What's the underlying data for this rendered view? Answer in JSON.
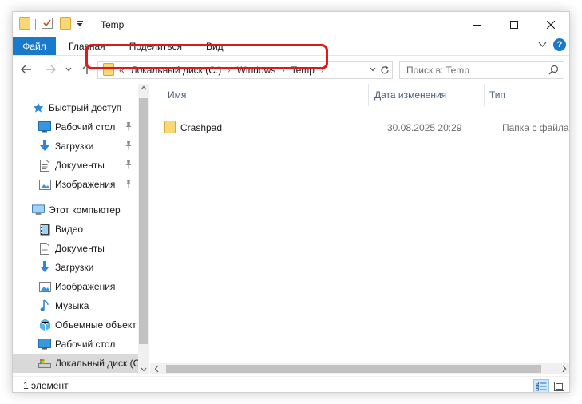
{
  "window": {
    "title": "Temp"
  },
  "ribbon": {
    "file_tab": "Файл",
    "tabs": [
      "Главная",
      "Поделиться",
      "Вид"
    ]
  },
  "address": {
    "overflow": "«",
    "crumbs": [
      "Локальный диск (C:)",
      "Windows",
      "Temp"
    ]
  },
  "search": {
    "placeholder": "Поиск в: Temp"
  },
  "sidebar": {
    "items": [
      {
        "label": "Быстрый доступ",
        "icon": "star-icon",
        "indent": 0,
        "pinned": false
      },
      {
        "label": "Рабочий стол",
        "icon": "desktop-icon",
        "indent": 1,
        "pinned": true
      },
      {
        "label": "Загрузки",
        "icon": "download-arrow-icon",
        "indent": 1,
        "pinned": true
      },
      {
        "label": "Документы",
        "icon": "document-icon",
        "indent": 1,
        "pinned": true
      },
      {
        "label": "Изображения",
        "icon": "pictures-icon",
        "indent": 1,
        "pinned": true
      },
      {
        "label": "Этот компьютер",
        "icon": "computer-icon",
        "indent": 0,
        "pinned": false
      },
      {
        "label": "Видео",
        "icon": "video-icon",
        "indent": 1,
        "pinned": false
      },
      {
        "label": "Документы",
        "icon": "document-icon",
        "indent": 1,
        "pinned": false
      },
      {
        "label": "Загрузки",
        "icon": "download-arrow-icon",
        "indent": 1,
        "pinned": false
      },
      {
        "label": "Изображения",
        "icon": "pictures-icon",
        "indent": 1,
        "pinned": false
      },
      {
        "label": "Музыка",
        "icon": "music-note-icon",
        "indent": 1,
        "pinned": false
      },
      {
        "label": "Объемные объект",
        "icon": "3d-objects-icon",
        "indent": 1,
        "pinned": false
      },
      {
        "label": "Рабочий стол",
        "icon": "desktop-icon",
        "indent": 1,
        "pinned": false
      },
      {
        "label": "Локальный диск (С",
        "icon": "drive-icon",
        "indent": 1,
        "pinned": false,
        "selected": true
      }
    ]
  },
  "content": {
    "columns": [
      "Имя",
      "Дата изменения",
      "Тип"
    ],
    "rows": [
      {
        "name": "Crashpad",
        "date": "30.08.2025 20:29",
        "type": "Папка с файлами"
      }
    ]
  },
  "status": {
    "count": "1 элемент"
  },
  "colors": {
    "accent": "#1979ca",
    "highlight": "#e11818",
    "folder": "#f8d775"
  }
}
